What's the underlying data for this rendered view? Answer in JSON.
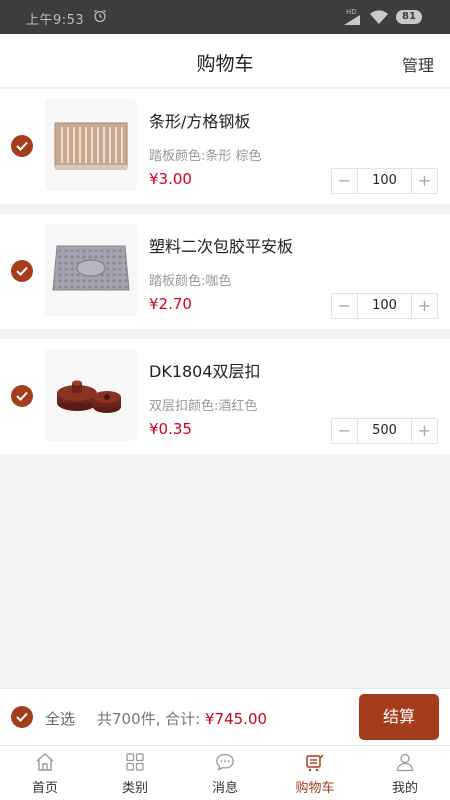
{
  "status_bar": {
    "time": "上午9:53",
    "network": "HD",
    "battery": "81"
  },
  "header": {
    "title": "购物车",
    "manage": "管理"
  },
  "items": [
    {
      "name": "条形/方格钢板",
      "spec": "踏板颜色:条形 棕色",
      "price": "¥3.00",
      "quantity": "100"
    },
    {
      "name": "塑料二次包胶平安板",
      "spec": "踏板颜色:咖色",
      "price": "¥2.70",
      "quantity": "100"
    },
    {
      "name": "DK1804双层扣",
      "spec": "双层扣颜色:酒红色",
      "price": "¥0.35",
      "quantity": "500"
    }
  ],
  "stepper": {
    "minus": "−",
    "plus": "+"
  },
  "footer": {
    "select_all": "全选",
    "count_text": "共700件, 合计: ",
    "total": "¥745.00",
    "checkout": "结算"
  },
  "tabs": [
    {
      "label": "首页",
      "icon": "home-icon"
    },
    {
      "label": "类别",
      "icon": "category-icon"
    },
    {
      "label": "消息",
      "icon": "message-icon"
    },
    {
      "label": "购物车",
      "icon": "cart-icon",
      "active": true
    },
    {
      "label": "我的",
      "icon": "profile-icon"
    }
  ],
  "colors": {
    "accent": "#a53d1c",
    "price": "#d0021b",
    "status_bar": "#3d3d3d"
  }
}
